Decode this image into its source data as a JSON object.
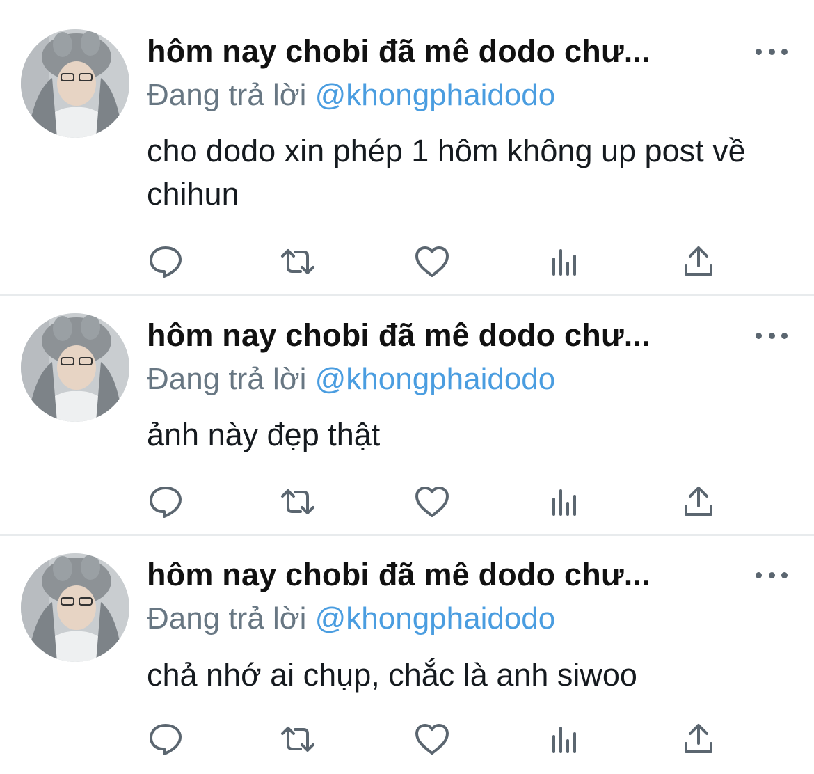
{
  "tweets": [
    {
      "display_name": "hôm nay chobi đã mê dodo chư...",
      "reply_prefix": "Đang trả lời",
      "reply_handle": "@khongphaidodo",
      "text": "cho dodo xin phép 1 hôm không up post về chihun"
    },
    {
      "display_name": "hôm nay chobi đã mê dodo chư...",
      "reply_prefix": "Đang trả lời",
      "reply_handle": "@khongphaidodo",
      "text": "ảnh này đẹp thật"
    },
    {
      "display_name": "hôm nay chobi đã mê dodo chư...",
      "reply_prefix": "Đang trả lời",
      "reply_handle": "@khongphaidodo",
      "text": "chả nhớ ai chụp, chắc là anh siwoo"
    }
  ],
  "actions": [
    "reply-icon",
    "retweet-icon",
    "like-icon",
    "analytics-icon",
    "share-icon"
  ],
  "colors": {
    "link": "#4a9de0",
    "secondary_text": "#687783",
    "icon": "#5b6670",
    "divider": "#e8ebed"
  }
}
